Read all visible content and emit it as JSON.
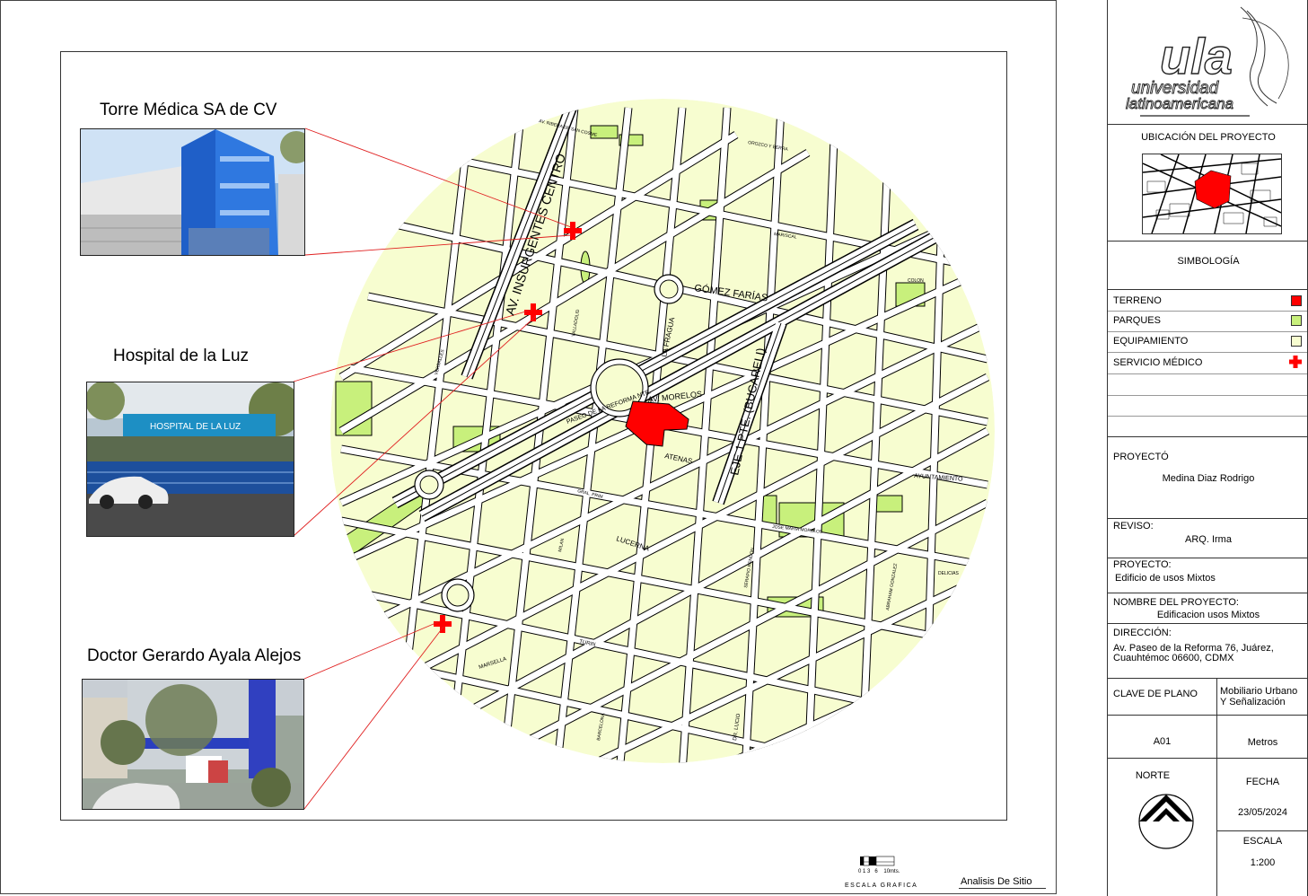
{
  "locations": [
    {
      "title": "Torre Médica SA de CV"
    },
    {
      "title": "Hospital de la Luz"
    },
    {
      "title": "Doctor Gerardo Ayala Alejos"
    }
  ],
  "photos": {
    "hospital_sign": "HOSPITAL DE LA LUZ"
  },
  "map": {
    "streets": {
      "insurgentes": "AV. INSURGENTES CENTRO",
      "gomez_farias": "GÓMEZ FARÍAS",
      "bucareli": "EJE 1 PTE. (BUCARELI)",
      "morelos": "AV. MORELOS",
      "reforma": "PASEO DE LA REFORMA NTE.",
      "atenas": "ATENAS",
      "lucerna": "LUCERNA",
      "la_fragua": "LA FRAGUA",
      "ayuntamiento": "AYUNTAMIENTO",
      "ribera": "AV. RIBERA DE SAN COSME",
      "marsella": "MARSELLA",
      "turin": "TURIN",
      "valladolid": "VALLADOLID",
      "dr_lucio": "DR. LUCIO",
      "jose_maria_morelos": "JOSE MARIA MORELOS",
      "serapio": "SERAPIO RENDON",
      "abraham": "ABRAHAM GONZALEZ",
      "versalles": "VERSALLES",
      "milan": "MILAN",
      "barcelona": "BARCELONA",
      "colon": "COLON",
      "delicias": "DELICIAS",
      "gral_prim": "GRAL. PRIM",
      "mariscal": "MARISCAL",
      "orozco": "OROZCO Y BERRA"
    },
    "colors": {
      "block": "#f7fdd0",
      "park": "#c8f07c",
      "terrain": "#ff0000",
      "medical": "#ff0000",
      "street": "#ffffff"
    }
  },
  "scale_bar": {
    "ticks": "0 1 3   6    10mts.",
    "label": "ESCALA GRAFICA"
  },
  "sheet_label": "Analisis De Sitio",
  "title_block": {
    "logo_line1": "universidad",
    "logo_line2": "latinoamericana",
    "logo_mark": "ula",
    "location_title": "UBICACIÓN DEL PROYECTO",
    "symbology_title": "SIMBOLOGÍA",
    "legend": [
      {
        "label": "TERRENO",
        "color": "#ff0000"
      },
      {
        "label": "PARQUES",
        "color": "#c8f07c"
      },
      {
        "label": "EQUIPAMIENTO",
        "color": "#f7fdd0"
      },
      {
        "label": "SERVICIO MÉDICO",
        "color": "#ff0000",
        "icon": "medical-cross-icon"
      }
    ],
    "project_label": "PROYECTÓ",
    "project_author": "Medina Diaz Rodrigo",
    "revised_label": "REVISO:",
    "revised_by": "ARQ. Irma",
    "project2_label": "PROYECTO:",
    "project2_value": "Edificio de usos Mixtos",
    "name_label": "NOMBRE DEL PROYECTO:",
    "name_value": "Edificacion usos Mixtos",
    "address_label": "DIRECCIÓN:",
    "address_line1": "Av. Paseo de la Reforma 76, Juárez,",
    "address_line2": "Cuauhtémoc 06600, CDMX",
    "plan_key_label": "CLAVE DE PLANO",
    "plan_key_line1": "Mobiliario Urbano",
    "plan_key_line2": "Y Señalización",
    "plan_code": "A01",
    "units": "Metros",
    "north_label": "NORTE",
    "date_label": "FECHA",
    "date_value": "23/05/2024",
    "scale_label": "ESCALA",
    "scale_value": "1:200"
  }
}
